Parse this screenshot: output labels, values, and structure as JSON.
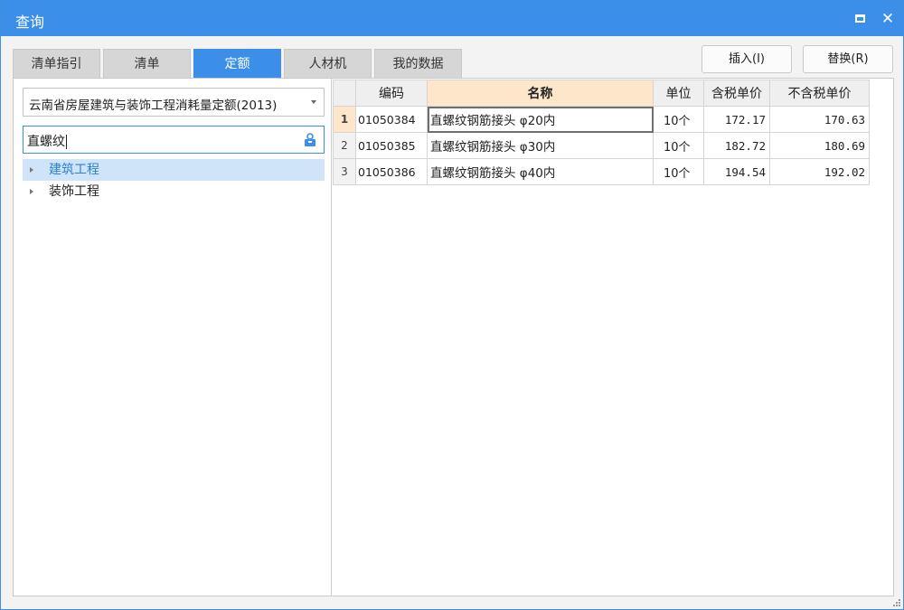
{
  "window": {
    "title": "查询",
    "maximize_icon": "maximize-icon",
    "close_symbol": "✕"
  },
  "tabs": [
    {
      "label": "清单指引",
      "active": false
    },
    {
      "label": "清单",
      "active": false
    },
    {
      "label": "定额",
      "active": true
    },
    {
      "label": "人材机",
      "active": false
    },
    {
      "label": "我的数据",
      "active": false
    }
  ],
  "actions": {
    "insert_label": "插入(I)",
    "replace_label": "替换(R)"
  },
  "left": {
    "quota_library": "云南省房屋建筑与装饰工程消耗量定额(2013)",
    "search_value": "直螺纹",
    "search_icon": "search-icon",
    "tree": [
      {
        "label": "建筑工程",
        "selected": true
      },
      {
        "label": "装饰工程",
        "selected": false
      }
    ]
  },
  "table": {
    "headers": {
      "code": "编码",
      "name": "名称",
      "unit": "单位",
      "price_tax": "含税单价",
      "price_notax": "不含税单价"
    },
    "rows": [
      {
        "no": "1",
        "code": "01050384",
        "name": "直螺纹钢筋接头 φ20内",
        "unit": "10个",
        "price_tax": "172.17",
        "price_notax": "170.63"
      },
      {
        "no": "2",
        "code": "01050385",
        "name": "直螺纹钢筋接头 φ30内",
        "unit": "10个",
        "price_tax": "182.72",
        "price_notax": "180.69"
      },
      {
        "no": "3",
        "code": "01050386",
        "name": "直螺纹钢筋接头 φ40内",
        "unit": "10个",
        "price_tax": "194.54",
        "price_notax": "192.02"
      }
    ]
  },
  "colors": {
    "accent": "#3b8fe8",
    "selected_bg": "#cfe4f9",
    "highlight_header": "#fde6c9"
  }
}
